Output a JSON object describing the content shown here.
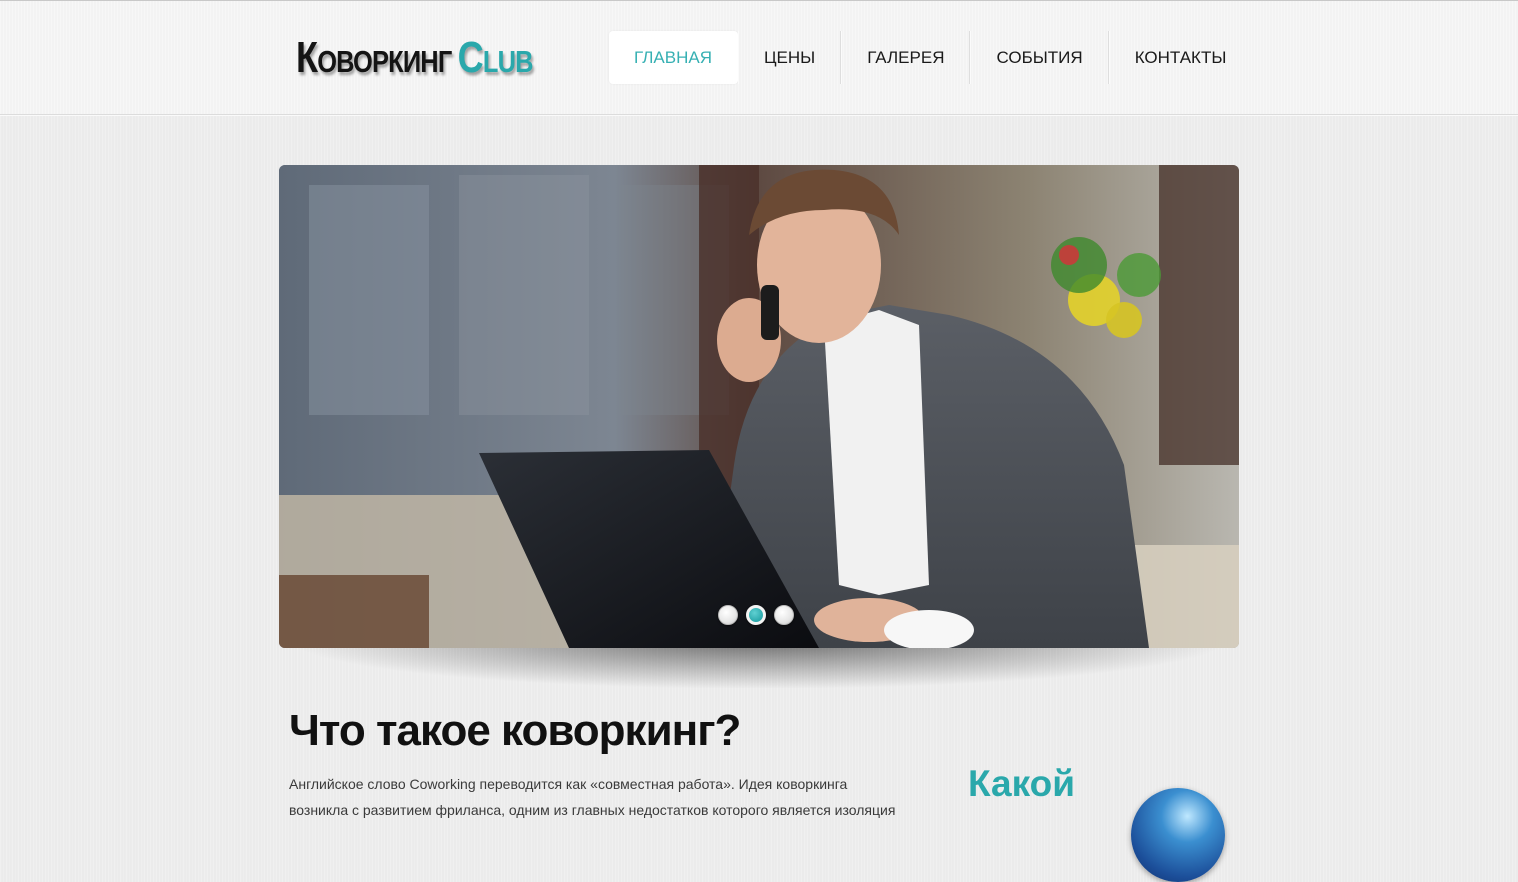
{
  "header": {
    "logo": {
      "word1": "Коворкинг",
      "word2": "Club"
    },
    "nav": [
      {
        "label": "ГЛАВНАЯ",
        "active": true
      },
      {
        "label": "ЦЕНЫ",
        "active": false
      },
      {
        "label": "ГАЛЕРЕЯ",
        "active": false
      },
      {
        "label": "СОБЫТИЯ",
        "active": false
      },
      {
        "label": "КОНТАКТЫ",
        "active": false
      }
    ]
  },
  "slider": {
    "image": "man-on-phone-with-laptop-photo",
    "dots": [
      {
        "active": false
      },
      {
        "active": true
      },
      {
        "active": false
      }
    ]
  },
  "main": {
    "title": "Что такое коворкинг?",
    "text": "Английское слово Coworking переводится как «совместная работа». Идея коворкинга возникла с развитием фриланса, одним из главных недостатков которого является изоляция"
  },
  "aside": {
    "title": "Какой",
    "icon": "globe-icon"
  },
  "colors": {
    "accent": "#2aa8ab",
    "text": "#1a1a1a",
    "background": "#ebebeb"
  }
}
